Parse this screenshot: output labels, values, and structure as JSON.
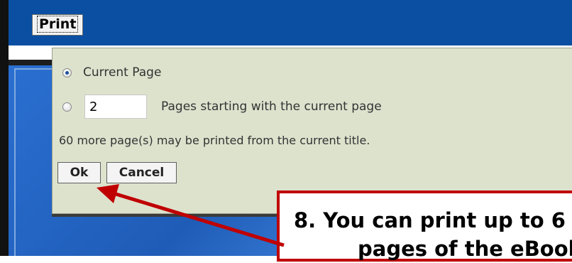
{
  "toolbar": {
    "print_label": "Print"
  },
  "dialog": {
    "option_current_page": "Current Page",
    "pages_value": "2",
    "option_pages_label": "Pages starting with the current page",
    "info_text": "60 more page(s) may be printed from the current title.",
    "ok_label": "Ok",
    "cancel_label": "Cancel"
  },
  "annotation": {
    "line1": "8. You can print up to 6",
    "line2": "pages of the eBook."
  },
  "colors": {
    "top_bar": "#0a4fa2",
    "dialog_bg": "#dde2cd",
    "annotation_red": "#c00000"
  },
  "icons": {
    "radio_selected": "radio-checked",
    "radio_unselected": "radio-unchecked",
    "arrow": "red-arrow"
  }
}
